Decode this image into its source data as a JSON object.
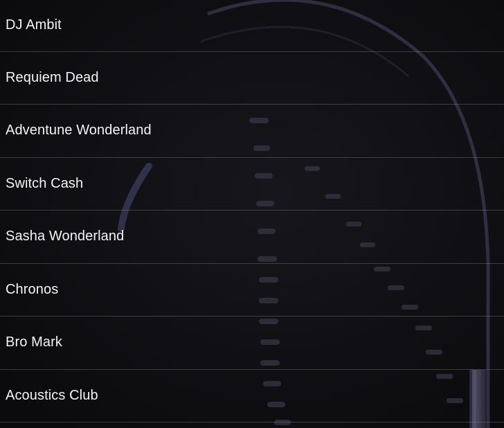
{
  "artists": [
    {
      "name": "DJ Ambit"
    },
    {
      "name": "Requiem Dead"
    },
    {
      "name": "Adventune Wonderland"
    },
    {
      "name": "Switch Cash"
    },
    {
      "name": "Sasha Wonderland"
    },
    {
      "name": "Chronos"
    },
    {
      "name": "Bro Mark"
    },
    {
      "name": "Acoustics Club"
    }
  ],
  "theme": {
    "background": "#0d0d0f",
    "text": "#f4f4f6",
    "divider": "#5a5a62",
    "background_art": "headphones-cable-photo"
  }
}
